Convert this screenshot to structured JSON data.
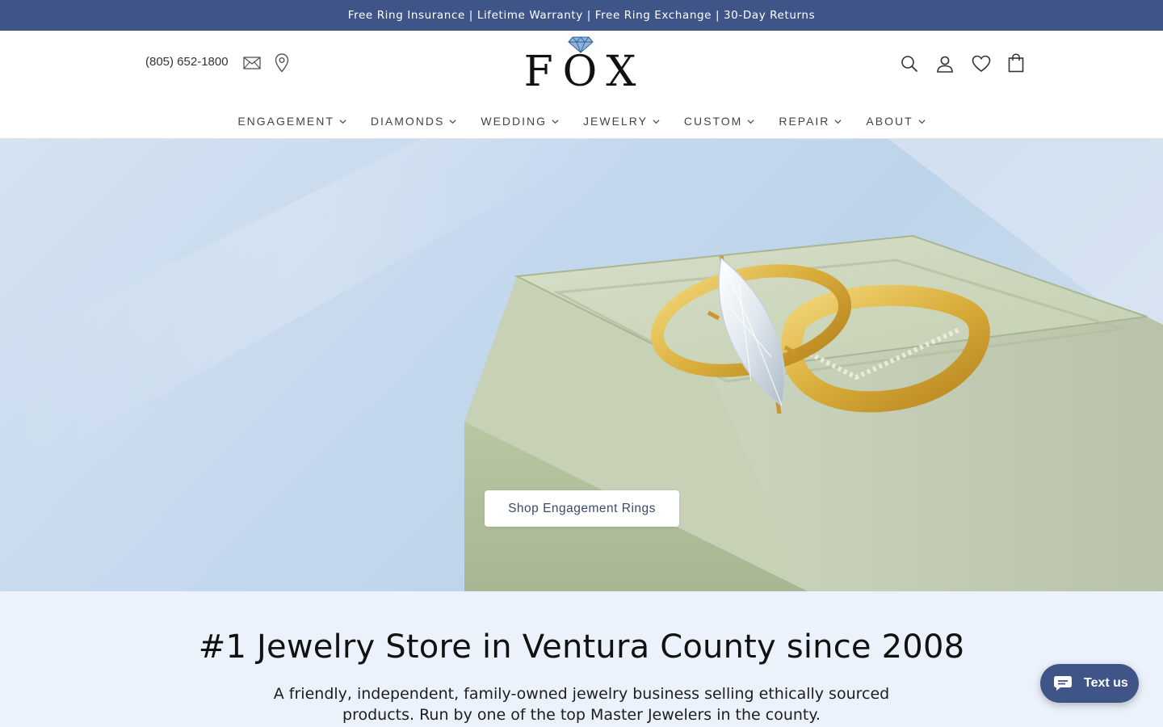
{
  "announcement": {
    "text": "Free Ring Insurance | Lifetime Warranty | Free Ring Exchange | 30-Day Returns",
    "bg_color": "#3f5487"
  },
  "header": {
    "phone": "(805) 652-1800",
    "left_icons": [
      "mail-icon",
      "location-pin-icon"
    ],
    "logo_text": "FOX",
    "right_icons": [
      "search-icon",
      "account-icon",
      "wishlist-heart-icon",
      "cart-bag-icon"
    ]
  },
  "nav": {
    "items": [
      {
        "label": "ENGAGEMENT"
      },
      {
        "label": "DIAMONDS"
      },
      {
        "label": "WEDDING"
      },
      {
        "label": "JEWELRY"
      },
      {
        "label": "CUSTOM"
      },
      {
        "label": "REPAIR"
      },
      {
        "label": "ABOUT"
      }
    ]
  },
  "hero": {
    "image_subject": "gold marquise diamond engagement ring with matching curved band on a sage green ring box",
    "cta_label": "Shop Engagement Rings"
  },
  "intro": {
    "heading": "#1 Jewelry Store in Ventura County since 2008",
    "body": "A friendly, independent, family-owned jewelry business selling ethically sourced products. Run by one of the top Master Jewelers in the county.",
    "bg_color": "#ebf2fb"
  },
  "chat_widget": {
    "label": "Text us",
    "icon": "chat-bubble-icon",
    "color": "#3f5487"
  }
}
